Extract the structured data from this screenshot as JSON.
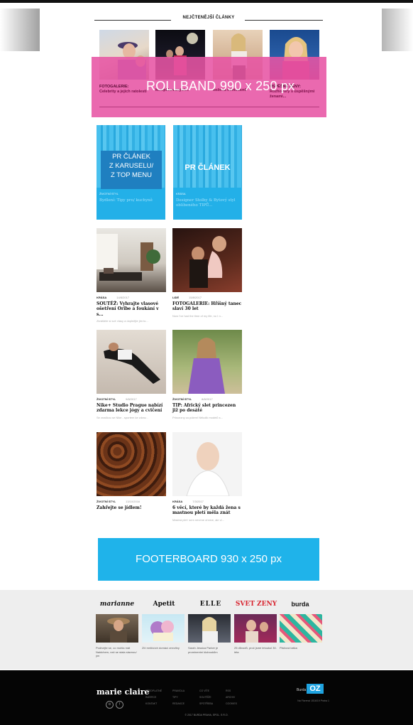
{
  "top_section": {
    "heading": "NEJČTENĚJŠÍ ČLÁNKY",
    "captions": [
      {
        "category": "FOTOGALERIE:",
        "text": "Celebrity a jejich ratolesti"
      },
      {
        "category": "",
        "text": "komplikovaných..."
      },
      {
        "category": "",
        "text": "kožená minisukně"
      },
      {
        "category": "ÚSPĚŠNÉ ŽENY:",
        "text": "Rozhovory s úspěšnými ženami..."
      }
    ]
  },
  "ads": {
    "rollband": "ROLLBAND 990 x 250 px",
    "footerboard": "FOOTERBOARD 930 x 250 px"
  },
  "pr_cards": [
    {
      "box_label": "PR ČLÁNEK Z KARUSELU/ Z TOP MENU",
      "line1": "PR ČLÁNEK",
      "line2": "Z KARUSELU/",
      "line3": "Z TOP MENU",
      "meta": "ŽIVOTNÍ STYL",
      "title": "Bydlení: Tipy pro/ kuchyně"
    },
    {
      "label": "PR ČLÁNEK",
      "meta": "KRÁSA",
      "title": "Designer Stolby & Bytový styl oblíbeného TIPŮ..."
    }
  ],
  "articles": [
    {
      "category": "KRÁSA",
      "date": "14/8/2017",
      "title": "SOUTĚŽ: Vyhrajte vlasové ošetření Oribe a foukání v s...",
      "perex": "Zkrášlete si své vlasy a doplnějte jim to..."
    },
    {
      "category": "LIDÉ",
      "date": "15/8/2017",
      "title": "FOTOGALERIE: Hříšný tanec slaví 30 let",
      "perex": "Now I've had the time of my life, no I n..."
    },
    {
      "category": "ŽIVOTNÍ STYL",
      "date": "9/8/2017",
      "title": "Nike+ Studio Prague nabízí zdarma lekce jógy a cvičení",
      "perex": "Se značkou se Nike - sportem ke zdrav..."
    },
    {
      "category": "ŽIVOTNÍ STYL",
      "date": "8/8/2017",
      "title": "TIP: Africký slet princezen již po desáté",
      "perex": "Princezny za pólem! Několik modelů s..."
    },
    {
      "category": "ŽIVOTNÍ STYL",
      "date": "13/10/2016",
      "title": "Zahřejte se jídlem!",
      "perex": ""
    },
    {
      "category": "KRÁSA",
      "date": "7/3/2017",
      "title": "6 věcí, které by každá žena s mastnou pletí měla znát",
      "perex": "Mastná pleť: sem nevíme ohnive, ale vi..."
    }
  ],
  "partners": [
    {
      "brand": "marianne",
      "caption": "Podívejte se, co mohla mát Naidchem, než se stala slavnou/ým",
      "color": "#111111"
    },
    {
      "brand": "Apetit",
      "caption": "Zlíí mrštících domácí zmrzliny",
      "color": "#111111"
    },
    {
      "brand": "ELLE",
      "caption": "Sarah Jessica Parker je prominentní kloboukům",
      "color": "#111111"
    },
    {
      "brand": "SVET ZENY",
      "caption": "25 důvodů, proč jsme letoukol 30. léta",
      "color": "#d8242f"
    },
    {
      "brand": "burda",
      "caption": "Plážová taška",
      "color": "#111111"
    }
  ],
  "footer": {
    "logo": "marie claire",
    "publisher": "Burda",
    "publisher_mark": "OZ",
    "address": "Na Florenci 1516/19 Praha 1",
    "links": [
      [
        "PŘEDPLATNÉ",
        "INZERCE",
        "KONTAKT"
      ],
      [
        "PRAVIDLA",
        "TIPY",
        "REDAKCE"
      ],
      [
        "CO VÍTE",
        "SOUTĚŽE",
        "SPOTŘEBA"
      ],
      [
        "RSS",
        "ARCHIV",
        "COOKIES"
      ]
    ],
    "copyright": "© 2017 BURDA PRAHA, SPOL. S R.O.",
    "social": [
      "⊚",
      "f"
    ]
  },
  "colors": {
    "rollband": "#e754a4",
    "pr": "#23b0e8",
    "footerboard": "#1fb3ea",
    "pr_box": "#1f7fc0"
  }
}
